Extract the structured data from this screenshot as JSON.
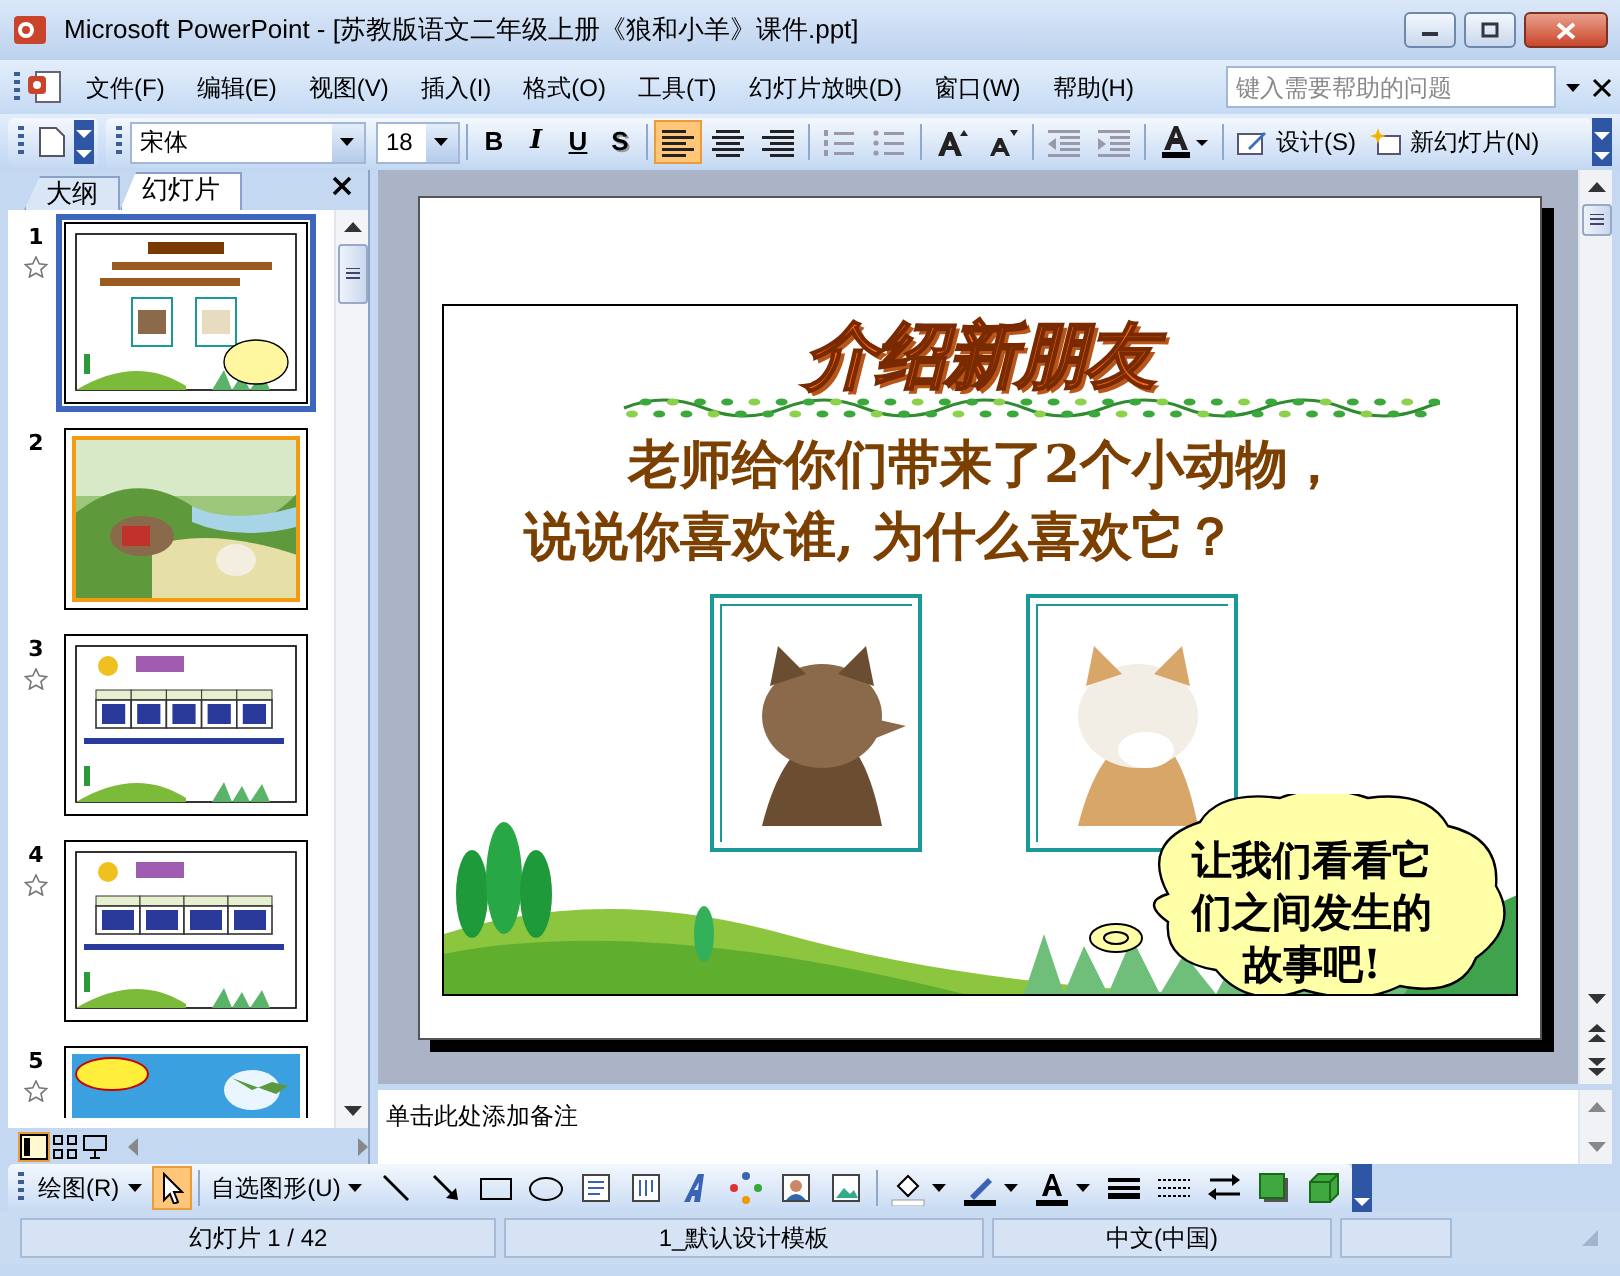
{
  "window": {
    "title": "Microsoft PowerPoint - [苏教版语文二年级上册《狼和小羊》课件.ppt]"
  },
  "menu": [
    "文件(F)",
    "编辑(E)",
    "视图(V)",
    "插入(I)",
    "格式(O)",
    "工具(T)",
    "幻灯片放映(D)",
    "窗口(W)",
    "帮助(H)"
  ],
  "help_box": {
    "placeholder": "键入需要帮助的问题"
  },
  "toolbar": {
    "font": "宋体",
    "size": "18",
    "format_buttons": [
      "B",
      "I",
      "U",
      "S"
    ],
    "align_buttons": [
      {
        "kind": "left",
        "selected": true
      },
      {
        "kind": "center",
        "selected": false
      },
      {
        "kind": "right",
        "selected": false
      }
    ],
    "design": "设计(S)",
    "new_slide": "新幻灯片(N)"
  },
  "pane_tabs": [
    {
      "label": "大纲",
      "selected": false
    },
    {
      "label": "幻灯片",
      "selected": true
    }
  ],
  "thumbnails": [
    {
      "number": "1",
      "selected": true,
      "animated": true,
      "kind": "picture"
    },
    {
      "number": "2",
      "selected": false,
      "animated": false,
      "kind": "picture"
    },
    {
      "number": "3",
      "selected": false,
      "animated": true,
      "kind": "picture"
    },
    {
      "number": "4",
      "selected": false,
      "animated": true,
      "kind": "picture"
    },
    {
      "number": "5",
      "selected": false,
      "animated": true,
      "kind": "picture"
    }
  ],
  "slide": {
    "title": "介绍新朋友",
    "lines": [
      "老师给你们带来了2个小动物，",
      "说说你喜欢谁, 为什么喜欢它？"
    ],
    "bubble": "让我们看看它们之间发生的故事吧!"
  },
  "notes": "单击此处添加备注",
  "drawing_toolbar": {
    "draw": "绘图(R)",
    "autoshapes": "自选图形(U)",
    "pointer_selected": true
  },
  "status_bar": [
    "幻灯片 1 / 42",
    "1_默认设计模板",
    "中文(中国)"
  ]
}
